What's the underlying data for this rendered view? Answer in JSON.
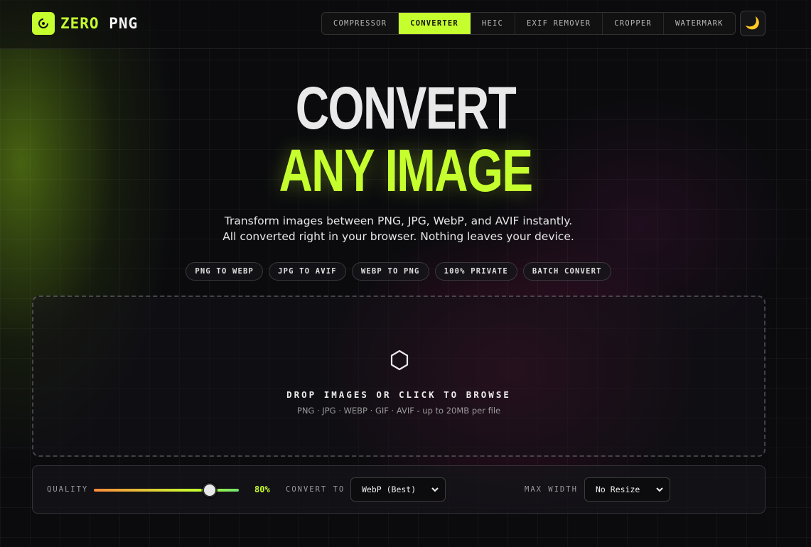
{
  "brand": {
    "name_accent": "ZERO",
    "name_rest": " PNG",
    "accent_color": "#c6ff2e"
  },
  "nav": {
    "tabs": [
      {
        "label": "COMPRESSOR",
        "active": false
      },
      {
        "label": "CONVERTER",
        "active": true
      },
      {
        "label": "HEIC",
        "active": false
      },
      {
        "label": "EXIF REMOVER",
        "active": false
      },
      {
        "label": "CROPPER",
        "active": false
      },
      {
        "label": "WATERMARK",
        "active": false
      }
    ],
    "theme_icon": "moon-icon",
    "theme_glyph": "🌙"
  },
  "hero": {
    "title_line1": "CONVERT",
    "title_line2": "ANY IMAGE",
    "subtitle_line1": "Transform images between PNG, JPG, WebP, and AVIF instantly.",
    "subtitle_line2": "All converted right in your browser. Nothing leaves your device."
  },
  "chips": [
    "PNG TO WEBP",
    "JPG TO AVIF",
    "WEBP TO PNG",
    "100% PRIVATE",
    "BATCH CONVERT"
  ],
  "dropzone": {
    "icon": "hexagon-icon",
    "title": "DROP IMAGES OR CLICK TO BROWSE",
    "subtitle": "PNG · JPG · WEBP · GIF · AVIF - up to 20MB per file"
  },
  "controls": {
    "quality_label": "QUALITY",
    "quality_value": "80%",
    "quality_fraction": 0.8,
    "convert_label": "CONVERT TO",
    "convert_value": "WebP (Best)",
    "max_width_label": "MAX WIDTH",
    "max_width_value": "No Resize"
  }
}
